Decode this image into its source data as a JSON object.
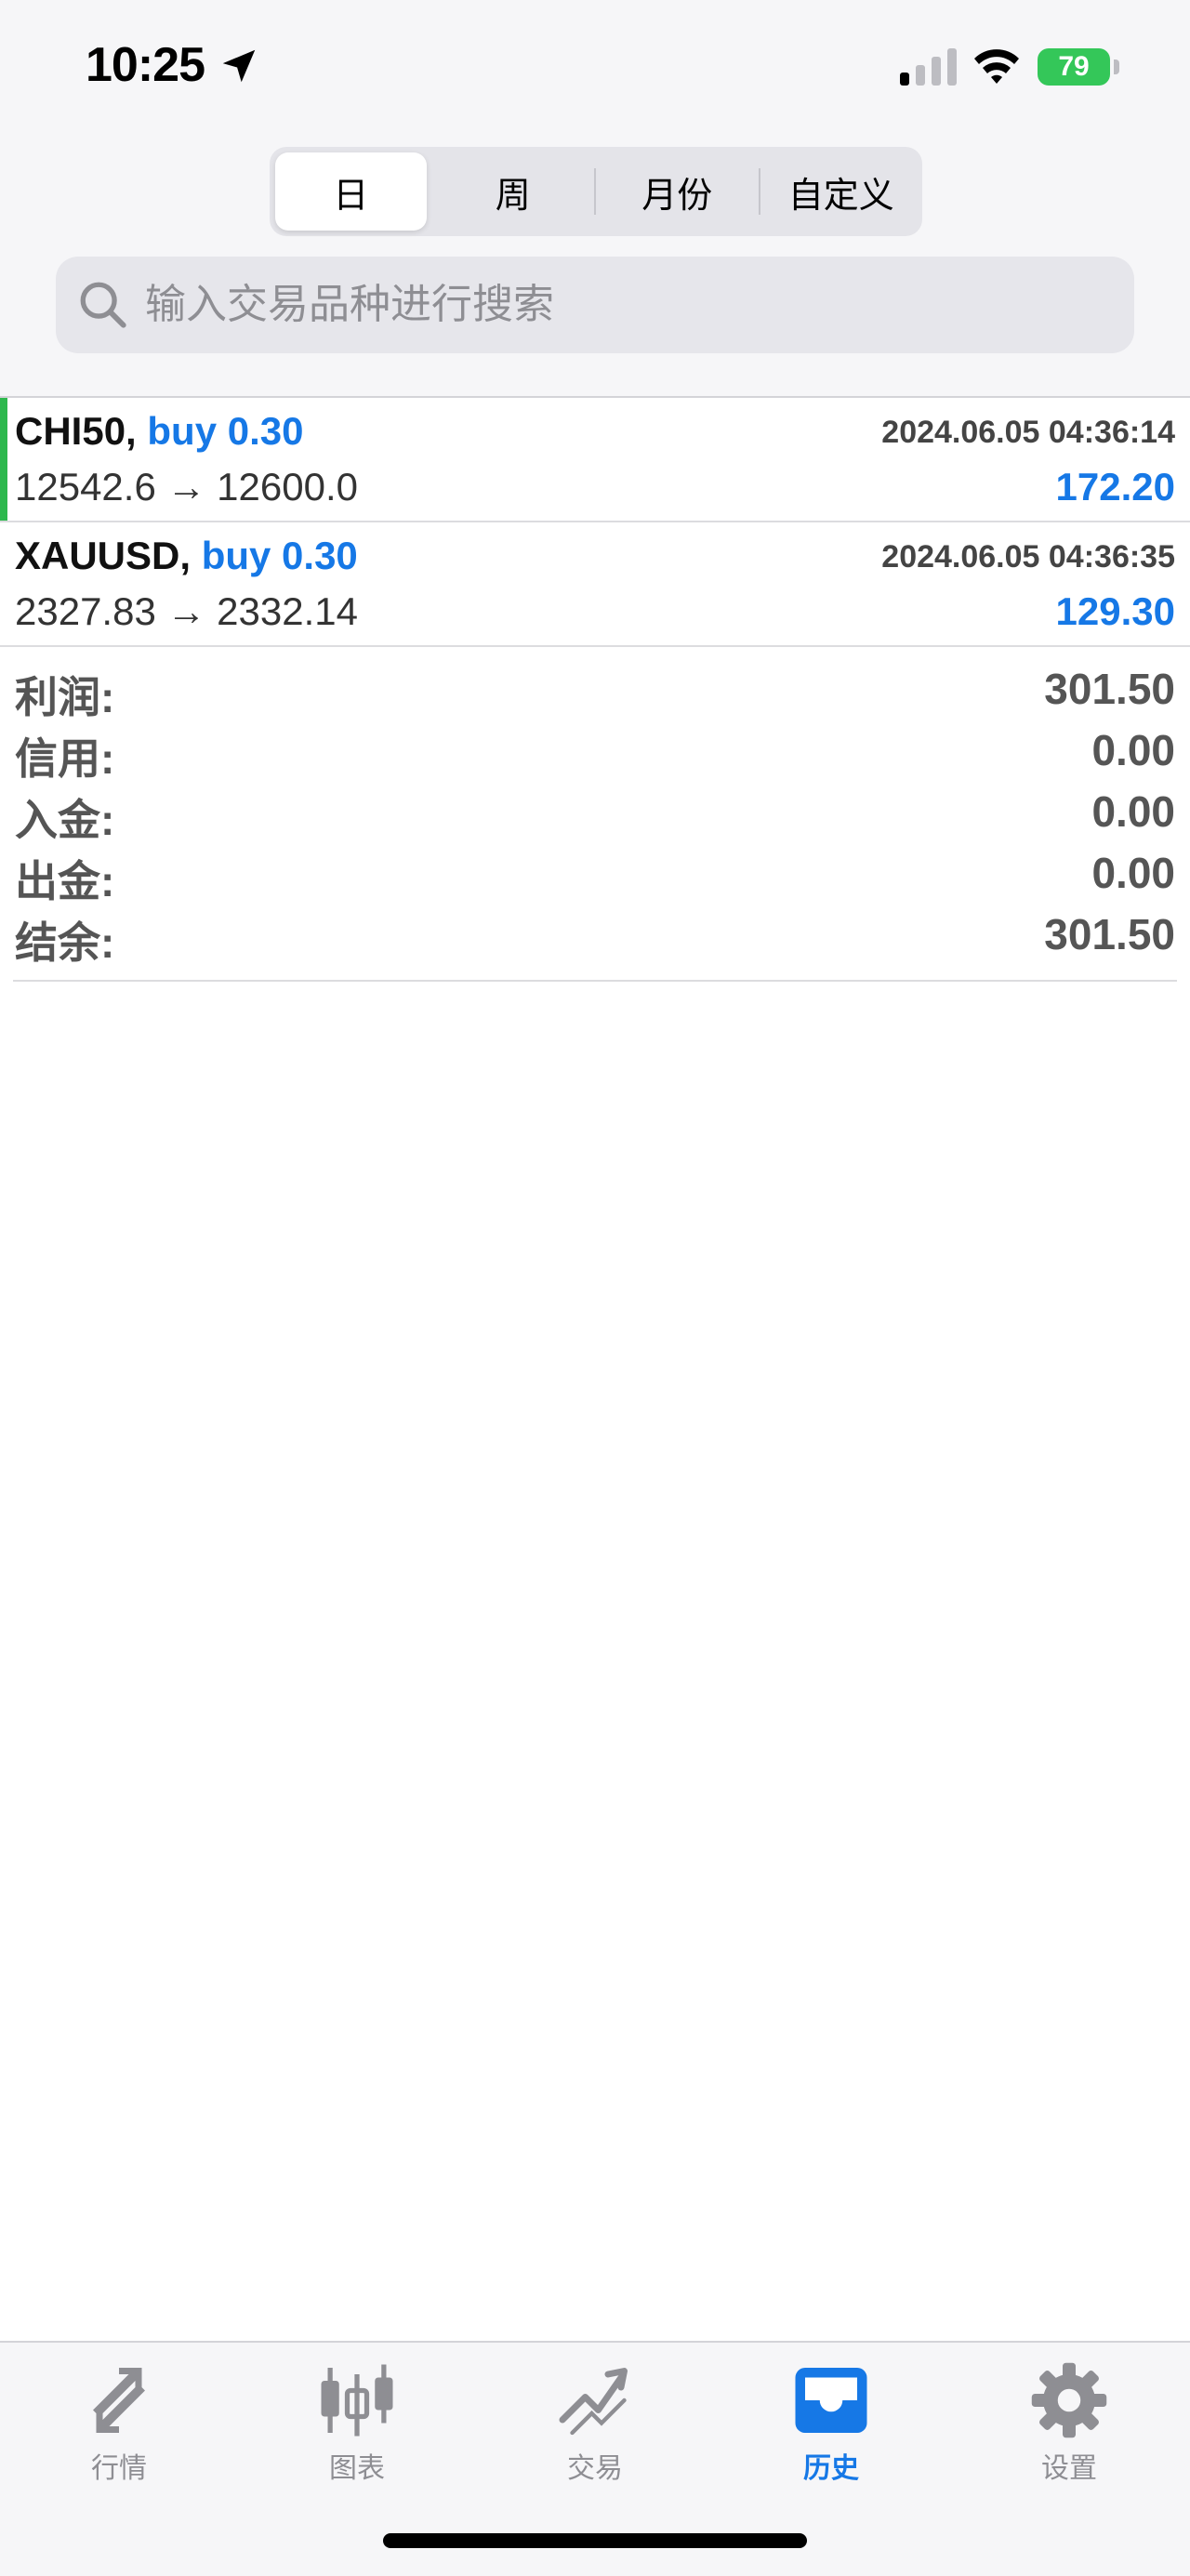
{
  "status_bar": {
    "time": "10:25",
    "battery": "79"
  },
  "segments": [
    {
      "label": "日",
      "active": true
    },
    {
      "label": "周",
      "active": false
    },
    {
      "label": "月份",
      "active": false
    },
    {
      "label": "自定义",
      "active": false
    }
  ],
  "search": {
    "placeholder": "输入交易品种进行搜索",
    "value": ""
  },
  "trades": [
    {
      "symbol": "CHI50,",
      "action": "buy 0.30",
      "time": "2024.06.05 04:36:14",
      "prices": "12542.6 → 12600.0",
      "profit": "172.20"
    },
    {
      "symbol": "XAUUSD,",
      "action": "buy 0.30",
      "time": "2024.06.05 04:36:35",
      "prices": "2327.83 → 2332.14",
      "profit": "129.30"
    }
  ],
  "summary": [
    {
      "label": "利润:",
      "value": "301.50"
    },
    {
      "label": "信用:",
      "value": "0.00"
    },
    {
      "label": "入金:",
      "value": "0.00"
    },
    {
      "label": "出金:",
      "value": "0.00"
    },
    {
      "label": "结余:",
      "value": "301.50"
    }
  ],
  "tabs": [
    {
      "label": "行情",
      "icon": "quotes-arrows-icon"
    },
    {
      "label": "图表",
      "icon": "candlestick-chart-icon"
    },
    {
      "label": "交易",
      "icon": "trade-trend-icon"
    },
    {
      "label": "历史",
      "icon": "history-inbox-icon",
      "active": true
    },
    {
      "label": "设置",
      "icon": "gear-icon"
    }
  ],
  "colors": {
    "accent": "#1678e6",
    "selected_bar": "#2db84d",
    "battery": "#34c759",
    "inactive": "#8e8e93"
  }
}
